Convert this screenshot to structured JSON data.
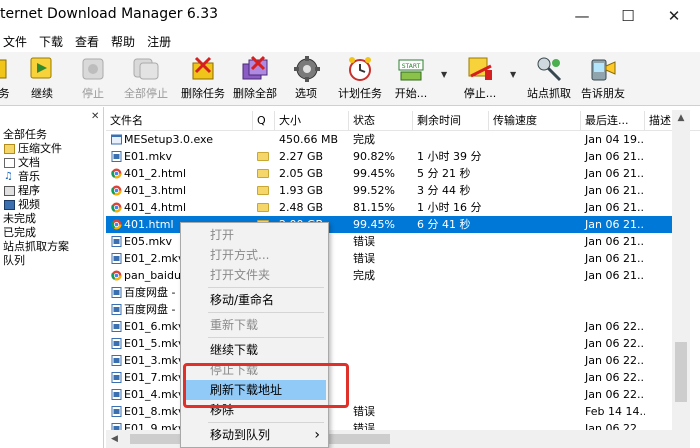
{
  "window": {
    "title": "ternet Download Manager 6.33"
  },
  "menu": [
    "文件",
    "下载",
    "查看",
    "帮助",
    "注册"
  ],
  "toolbar": [
    {
      "label": "务",
      "icon": "task-icon",
      "enabled": true
    },
    {
      "label": "继续",
      "icon": "resume-icon",
      "enabled": true
    },
    {
      "label": "停止",
      "icon": "stop-icon",
      "enabled": false
    },
    {
      "label": "全部停止",
      "icon": "stop-all-icon",
      "enabled": false
    },
    {
      "label": "删除任务",
      "icon": "delete-task-icon",
      "enabled": true
    },
    {
      "label": "删除全部",
      "icon": "delete-all-icon",
      "enabled": true
    },
    {
      "label": "选项",
      "icon": "options-gear-icon",
      "enabled": true
    },
    {
      "label": "计划任务",
      "icon": "scheduler-clock-icon",
      "enabled": true
    },
    {
      "label": "开始...",
      "icon": "start-queue-icon",
      "enabled": true
    },
    {
      "label": "停止...",
      "icon": "stop-queue-icon",
      "enabled": true
    },
    {
      "label": "站点抓取",
      "icon": "site-grabber-icon",
      "enabled": true
    },
    {
      "label": "告诉朋友",
      "icon": "tell-friend-icon",
      "enabled": true
    }
  ],
  "tree": [
    {
      "label": "全部任务",
      "icon": ""
    },
    {
      "label": "压缩文件",
      "icon": "archive-icon"
    },
    {
      "label": "文档",
      "icon": "document-icon"
    },
    {
      "label": "音乐",
      "icon": "music-icon"
    },
    {
      "label": "程序",
      "icon": "program-icon"
    },
    {
      "label": "视频",
      "icon": "video-icon"
    },
    {
      "label": "未完成",
      "icon": ""
    },
    {
      "label": "已完成",
      "icon": ""
    },
    {
      "label": "站点抓取方案",
      "icon": ""
    },
    {
      "label": "队列",
      "icon": ""
    }
  ],
  "columns": [
    "文件名",
    "Q",
    "大小",
    "状态",
    "剩余时间",
    "传输速度",
    "最后连...",
    "描述"
  ],
  "rows": [
    {
      "name": "MESetup3.0.exe",
      "icon": "exe",
      "q": false,
      "size": "450.66  MB",
      "status": "完成",
      "remaining": "",
      "speed": "",
      "last": "Jan 04 19...",
      "selected": false
    },
    {
      "name": "E01.mkv",
      "icon": "mkv",
      "q": true,
      "size": "2.27  GB",
      "status": "90.82%",
      "remaining": "1 小时 39 分",
      "speed": "",
      "last": "Jan 06 21...",
      "selected": false
    },
    {
      "name": "401_2.html",
      "icon": "html",
      "q": true,
      "size": "2.05  GB",
      "status": "99.45%",
      "remaining": "5 分 21 秒",
      "speed": "",
      "last": "Jan 06 21...",
      "selected": false
    },
    {
      "name": "401_3.html",
      "icon": "html",
      "q": true,
      "size": "1.93  GB",
      "status": "99.52%",
      "remaining": "3 分 44 秒",
      "speed": "",
      "last": "Jan 06 21...",
      "selected": false
    },
    {
      "name": "401_4.html",
      "icon": "html",
      "q": true,
      "size": "2.48  GB",
      "status": "81.15%",
      "remaining": "1 小时 16 分",
      "speed": "",
      "last": "Jan 06 21...",
      "selected": false
    },
    {
      "name": "401.html",
      "icon": "html",
      "q": true,
      "size": "2.00  GB",
      "status": "99.45%",
      "remaining": "6 分 41 秒",
      "speed": "",
      "last": "Jan 06 21...",
      "selected": true
    },
    {
      "name": "E05.mkv",
      "icon": "mkv",
      "q": false,
      "size": "",
      "status": "错误",
      "remaining": "",
      "speed": "",
      "last": "Jan 06 21...",
      "selected": false
    },
    {
      "name": "E01_2.mkv",
      "icon": "mkv",
      "q": false,
      "size": "",
      "status": "错误",
      "remaining": "",
      "speed": "",
      "last": "Jan 06 21...",
      "selected": false
    },
    {
      "name": "pan_baidu_c",
      "icon": "html",
      "q": false,
      "size": "",
      "status": "完成",
      "remaining": "",
      "speed": "",
      "last": "Jan 06 21...",
      "selected": false
    },
    {
      "name": "百度网盘 -",
      "icon": "mkv",
      "q": false,
      "size": "",
      "status": "",
      "remaining": "",
      "speed": "",
      "last": "",
      "selected": false
    },
    {
      "name": "百度网盘 -",
      "icon": "mkv",
      "q": false,
      "size": "",
      "status": "",
      "remaining": "",
      "speed": "",
      "last": "",
      "selected": false
    },
    {
      "name": "E01_6.mkv",
      "icon": "mkv",
      "q": false,
      "size": "",
      "status": "",
      "remaining": "",
      "speed": "",
      "last": "Jan 06 22...",
      "selected": false
    },
    {
      "name": "E01_5.mkv",
      "icon": "mkv",
      "q": false,
      "size": "",
      "status": "",
      "remaining": "",
      "speed": "",
      "last": "Jan 06 22...",
      "selected": false
    },
    {
      "name": "E01_3.mkv",
      "icon": "mkv",
      "q": false,
      "size": "",
      "status": "",
      "remaining": "",
      "speed": "",
      "last": "Jan 06 22...",
      "selected": false
    },
    {
      "name": "E01_7.mkv",
      "icon": "mkv",
      "q": false,
      "size": "",
      "status": "",
      "remaining": "",
      "speed": "",
      "last": "Jan 06 22...",
      "selected": false
    },
    {
      "name": "E01_4.mkv",
      "icon": "mkv",
      "q": false,
      "size": "",
      "status": "",
      "remaining": "",
      "speed": "",
      "last": "Jan 06 22...",
      "selected": false
    },
    {
      "name": "E01_8.mkv",
      "icon": "mkv",
      "q": false,
      "size": "",
      "status": "错误",
      "remaining": "",
      "speed": "",
      "last": "Feb 14 14...",
      "selected": false
    },
    {
      "name": "E01_9.mkv",
      "icon": "mkv",
      "q": false,
      "size": "",
      "status": "错误",
      "remaining": "",
      "speed": "",
      "last": "Jan 06 22...",
      "selected": false
    }
  ],
  "context_menu": [
    {
      "label": "打开",
      "enabled": false,
      "highlight": false,
      "submenu": false
    },
    {
      "label": "打开方式...",
      "enabled": false,
      "highlight": false,
      "submenu": false
    },
    {
      "label": "打开文件夹",
      "enabled": false,
      "highlight": false,
      "submenu": false
    },
    {
      "separator": true
    },
    {
      "label": "移动/重命名",
      "enabled": true,
      "highlight": false,
      "submenu": false
    },
    {
      "separator": true
    },
    {
      "label": "重新下载",
      "enabled": false,
      "highlight": false,
      "submenu": false
    },
    {
      "separator": true
    },
    {
      "label": "继续下载",
      "enabled": true,
      "highlight": false,
      "submenu": false
    },
    {
      "label": "停止下载",
      "enabled": false,
      "highlight": false,
      "submenu": false
    },
    {
      "label": "刷新下载地址",
      "enabled": true,
      "highlight": true,
      "submenu": false
    },
    {
      "label": "移除",
      "enabled": true,
      "highlight": false,
      "submenu": false
    },
    {
      "separator": true
    },
    {
      "label": "移动到队列",
      "enabled": true,
      "highlight": false,
      "submenu": true
    }
  ],
  "colors": {
    "selection": "#0078d7",
    "menu_highlight": "#91c9f7",
    "callout": "#e0302a"
  }
}
